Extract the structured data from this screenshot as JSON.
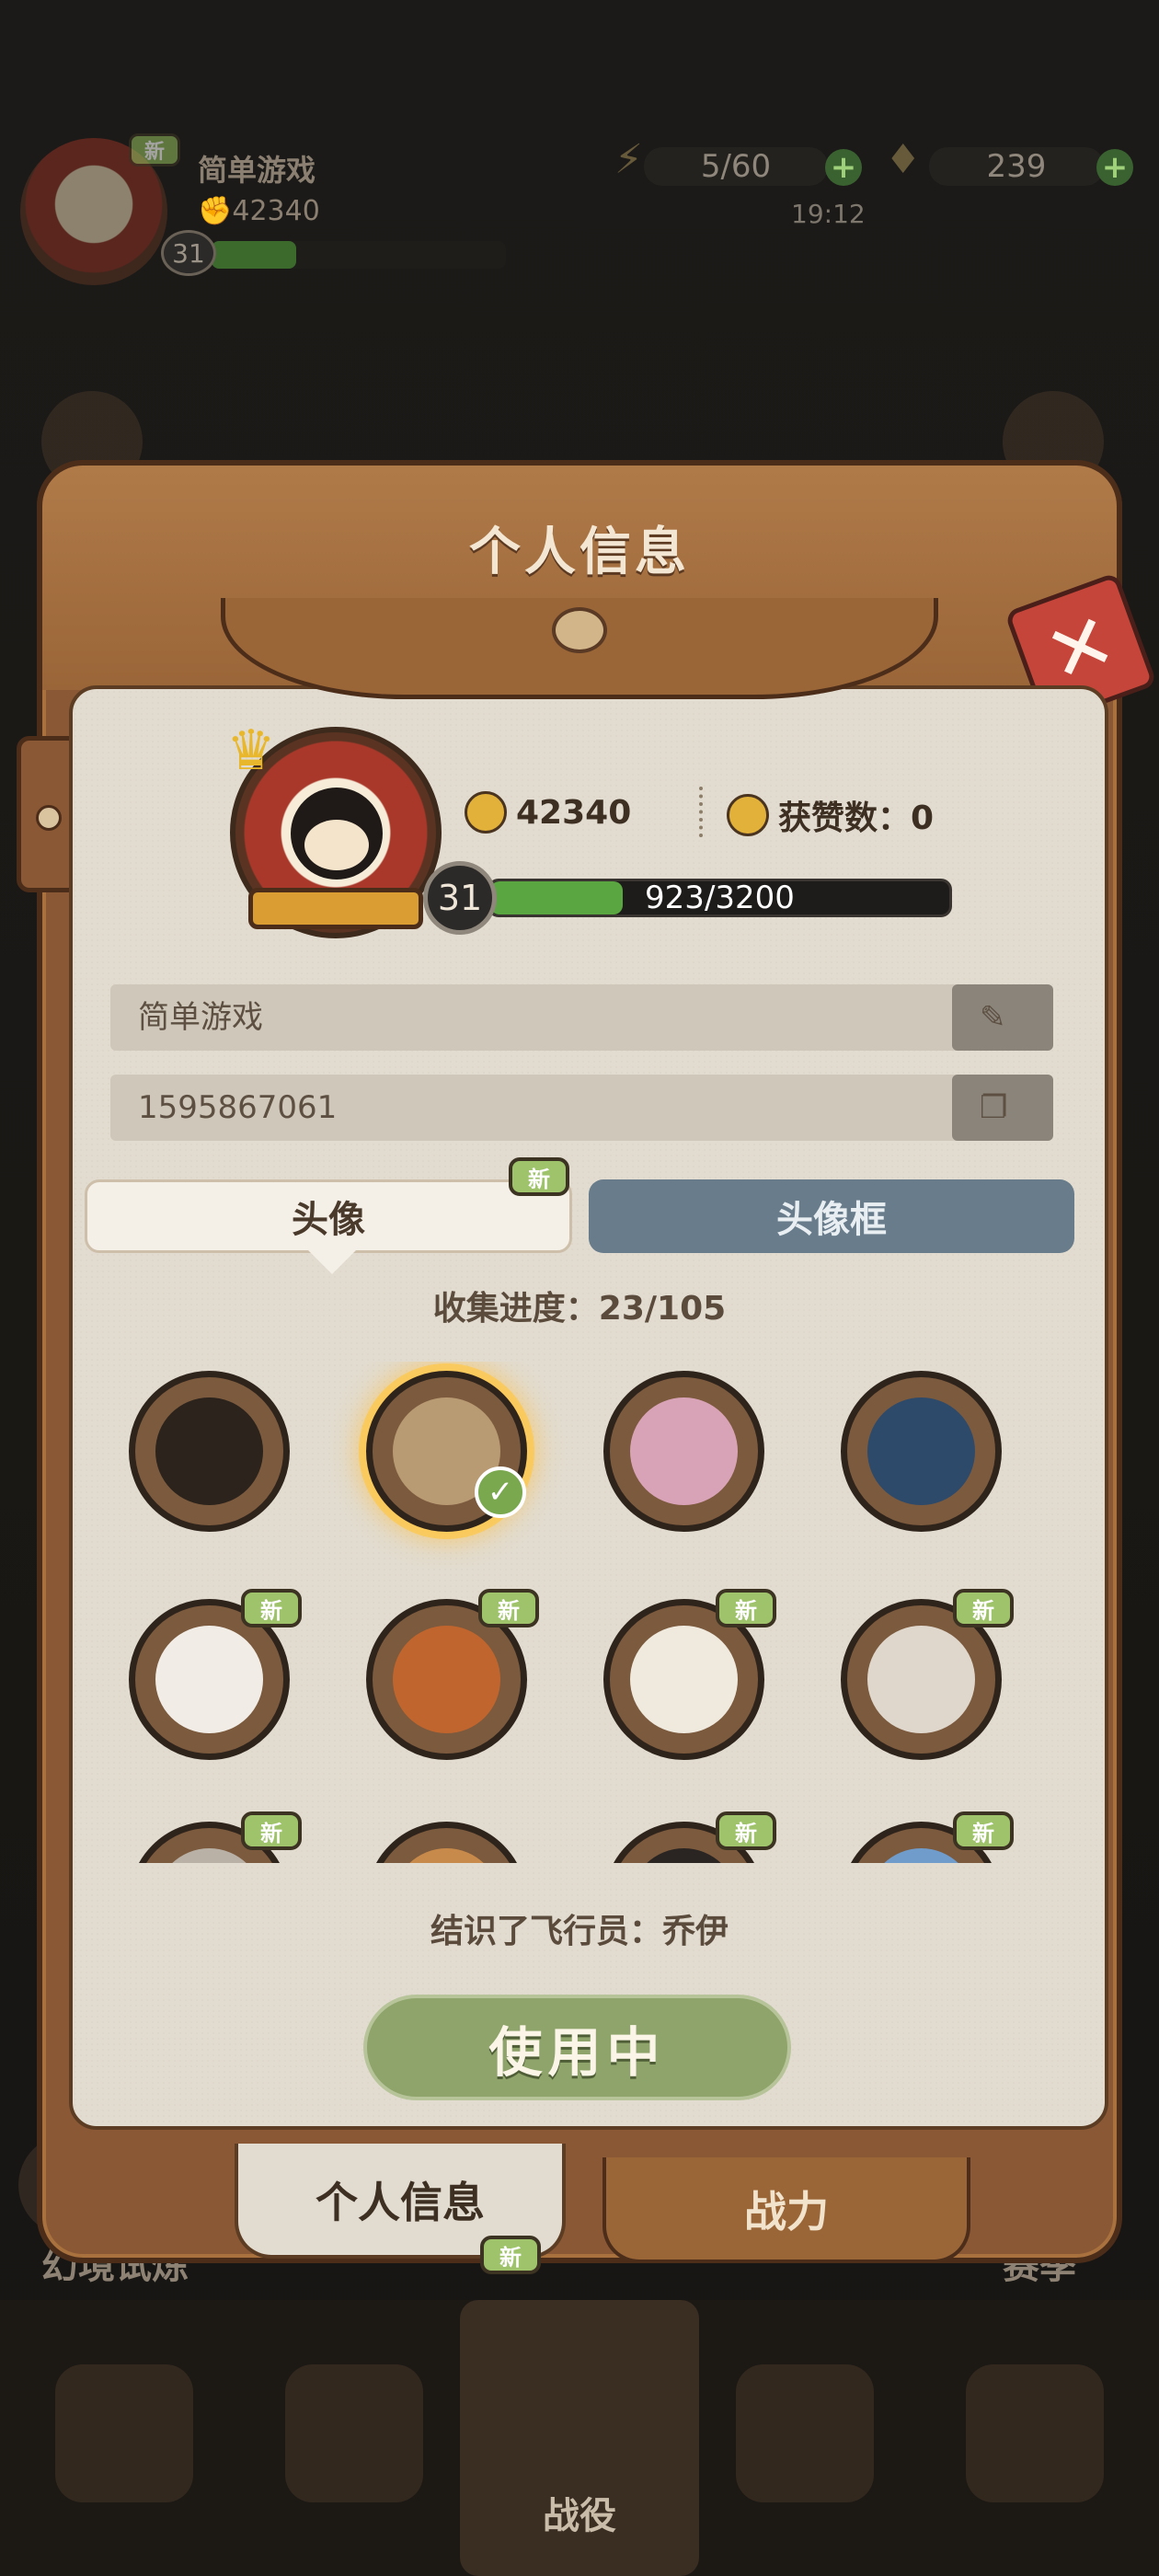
{
  "hud": {
    "player_name": "简单游戏",
    "power": "42340",
    "level": "31",
    "level_progress_fraction": 0.288,
    "energy": "5/60",
    "gems": "239",
    "timer": "19:12",
    "new_badge": "新"
  },
  "modal": {
    "title": "个人信息",
    "close_icon": "close-icon",
    "profile": {
      "power": "42340",
      "likes_label": "获赞数：0",
      "level": "31",
      "xp_text": "923/3200",
      "xp_fraction": 0.288,
      "name": "简单游戏",
      "uid": "1595867061"
    },
    "tabs": [
      {
        "label": "头像",
        "active": true,
        "new": "新"
      },
      {
        "label": "头像框",
        "active": false
      }
    ],
    "collection_progress": "收集进度：23/105",
    "avatars": [
      {
        "color": "#2b231c",
        "selected": false,
        "new": ""
      },
      {
        "color": "#b89a73",
        "selected": true,
        "new": ""
      },
      {
        "color": "#d9a3b7",
        "selected": false,
        "new": ""
      },
      {
        "color": "#2e4a6a",
        "selected": false,
        "new": ""
      },
      {
        "color": "#f1ede6",
        "selected": false,
        "new": "新"
      },
      {
        "color": "#c0652d",
        "selected": false,
        "new": "新"
      },
      {
        "color": "#efe9de",
        "selected": false,
        "new": "新"
      },
      {
        "color": "#dfd7cc",
        "selected": false,
        "new": "新"
      },
      {
        "color": "#b9b1a6",
        "selected": false,
        "new": "新"
      },
      {
        "color": "#c88a4a",
        "selected": false,
        "new": ""
      },
      {
        "color": "#2a2522",
        "selected": false,
        "new": "新"
      },
      {
        "color": "#6f9ccb",
        "selected": false,
        "new": "新"
      }
    ],
    "description": "结识了飞行员：乔伊",
    "use_button": "使用中",
    "bottom_tabs": [
      {
        "label": "个人信息",
        "active": true,
        "new": "新"
      },
      {
        "label": "战力",
        "active": false
      }
    ]
  },
  "background": {
    "left_label": "幻境试炼",
    "right_label": "赛季",
    "dock_center": "战役"
  }
}
